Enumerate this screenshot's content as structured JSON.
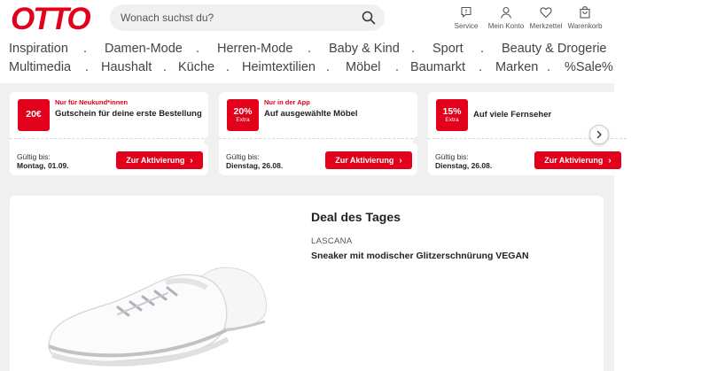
{
  "header": {
    "logo_text": "OTTO",
    "search_placeholder": "Wonach suchst du?",
    "nav": [
      {
        "label": "Service",
        "icon": "chat-icon"
      },
      {
        "label": "Mein Konto",
        "icon": "user-icon"
      },
      {
        "label": "Merkzettel",
        "icon": "heart-icon"
      },
      {
        "label": "Warenkorb",
        "icon": "cart-icon"
      }
    ]
  },
  "categories": {
    "row1": [
      "Inspiration",
      ".",
      "Damen-Mode",
      ".",
      "Herren-Mode",
      ".",
      "Baby & Kind",
      ".",
      "Sport",
      ".",
      "Beauty & Drogerie"
    ],
    "row2": [
      "Multimedia",
      ".",
      "Haushalt",
      ".",
      "Küche",
      ".",
      "Heimtextilien",
      ".",
      "Möbel",
      ".",
      "Baumarkt",
      ".",
      "Marken",
      ".",
      "%Sale%"
    ]
  },
  "coupons": [
    {
      "badge": "20€",
      "badge_sub": "",
      "note": "Nur für Neukund*innen",
      "text": "Gutschein für deine erste Bestellung",
      "valid_label": "Gültig bis:",
      "valid_date": "Montag, 01.09.",
      "button": "Zur Aktivierung"
    },
    {
      "badge": "20%",
      "badge_sub": "Extra",
      "note": "Nur in der App",
      "text": "Auf ausgewählte Möbel",
      "valid_label": "Gültig bis:",
      "valid_date": "Dienstag, 26.08.",
      "button": "Zur Aktivierung"
    },
    {
      "badge": "15%",
      "badge_sub": "Extra",
      "note": "",
      "text": "Auf viele Fernseher",
      "valid_label": "Gültig bis:",
      "valid_date": "Dienstag, 26.08.",
      "button": "Zur Aktivierung"
    }
  ],
  "deal": {
    "title": "Deal des Tages",
    "brand": "LASCANA",
    "product": "Sneaker mit modischer Glitzerschnürung VEGAN"
  },
  "colors": {
    "brand_red": "#e2001a",
    "background_grey": "#f0f0f0"
  }
}
